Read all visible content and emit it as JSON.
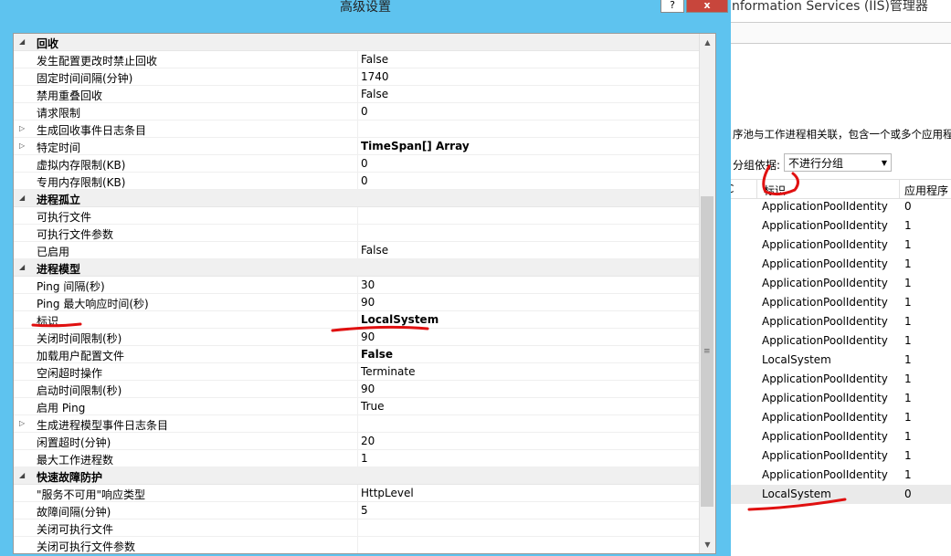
{
  "dialog": {
    "title": "高级设置",
    "help_label": "?",
    "close_label": "x"
  },
  "rows": [
    {
      "type": "category",
      "name": "回收",
      "expanded": true
    },
    {
      "type": "prop",
      "name": "发生配置更改时禁止回收",
      "value": "False"
    },
    {
      "type": "prop",
      "name": "固定时间间隔(分钟)",
      "value": "1740"
    },
    {
      "type": "prop",
      "name": "禁用重叠回收",
      "value": "False"
    },
    {
      "type": "prop",
      "name": "请求限制",
      "value": "0"
    },
    {
      "type": "prop",
      "name": "生成回收事件日志条目",
      "value": "",
      "expandable": true
    },
    {
      "type": "prop",
      "name": "特定时间",
      "value": "TimeSpan[] Array",
      "bold": true,
      "expandable": true
    },
    {
      "type": "prop",
      "name": "虚拟内存限制(KB)",
      "value": "0"
    },
    {
      "type": "prop",
      "name": "专用内存限制(KB)",
      "value": "0"
    },
    {
      "type": "category",
      "name": "进程孤立",
      "expanded": true
    },
    {
      "type": "prop",
      "name": "可执行文件",
      "value": ""
    },
    {
      "type": "prop",
      "name": "可执行文件参数",
      "value": ""
    },
    {
      "type": "prop",
      "name": "已启用",
      "value": "False"
    },
    {
      "type": "category",
      "name": "进程模型",
      "expanded": true
    },
    {
      "type": "prop",
      "name": "Ping 间隔(秒)",
      "value": "30"
    },
    {
      "type": "prop",
      "name": "Ping 最大响应时间(秒)",
      "value": "90"
    },
    {
      "type": "prop",
      "name": "标识",
      "value": "LocalSystem",
      "bold": true
    },
    {
      "type": "prop",
      "name": "关闭时间限制(秒)",
      "value": "90"
    },
    {
      "type": "prop",
      "name": "加载用户配置文件",
      "value": "False",
      "bold": true
    },
    {
      "type": "prop",
      "name": "空闲超时操作",
      "value": "Terminate"
    },
    {
      "type": "prop",
      "name": "启动时间限制(秒)",
      "value": "90"
    },
    {
      "type": "prop",
      "name": "启用 Ping",
      "value": "True"
    },
    {
      "type": "prop",
      "name": "生成进程模型事件日志条目",
      "value": "",
      "expandable": true
    },
    {
      "type": "prop",
      "name": "闲置超时(分钟)",
      "value": "20"
    },
    {
      "type": "prop",
      "name": "最大工作进程数",
      "value": "1"
    },
    {
      "type": "category",
      "name": "快速故障防护",
      "expanded": true
    },
    {
      "type": "prop",
      "name": "\"服务不可用\"响应类型",
      "value": "HttpLevel"
    },
    {
      "type": "prop",
      "name": "故障间隔(分钟)",
      "value": "5"
    },
    {
      "type": "prop",
      "name": "关闭可执行文件",
      "value": ""
    },
    {
      "type": "prop",
      "name": "关闭可执行文件参数",
      "value": ""
    }
  ],
  "background": {
    "title": "nformation Services (IIS)管理器",
    "description": "序池与工作进程相关联，包含一个或多个应用程",
    "group_label": "分组依据:",
    "group_value": "不进行分组",
    "columns": [
      "C",
      "标识",
      "应用程序"
    ],
    "pools": [
      {
        "identity": "ApplicationPoolIdentity",
        "apps": "0"
      },
      {
        "identity": "ApplicationPoolIdentity",
        "apps": "1"
      },
      {
        "identity": "ApplicationPoolIdentity",
        "apps": "1"
      },
      {
        "identity": "ApplicationPoolIdentity",
        "apps": "1"
      },
      {
        "identity": "ApplicationPoolIdentity",
        "apps": "1"
      },
      {
        "identity": "ApplicationPoolIdentity",
        "apps": "1"
      },
      {
        "identity": "ApplicationPoolIdentity",
        "apps": "1"
      },
      {
        "identity": "ApplicationPoolIdentity",
        "apps": "1"
      },
      {
        "identity": "LocalSystem",
        "apps": "1"
      },
      {
        "identity": "ApplicationPoolIdentity",
        "apps": "1"
      },
      {
        "identity": "ApplicationPoolIdentity",
        "apps": "1"
      },
      {
        "identity": "ApplicationPoolIdentity",
        "apps": "1"
      },
      {
        "identity": "ApplicationPoolIdentity",
        "apps": "1"
      },
      {
        "identity": "ApplicationPoolIdentity",
        "apps": "1"
      },
      {
        "identity": "ApplicationPoolIdentity",
        "apps": "1"
      },
      {
        "identity": "LocalSystem",
        "apps": "0",
        "selected": true
      }
    ]
  },
  "scrollbar": {
    "up_icon": "up-arrow-icon",
    "down_icon": "down-arrow-icon",
    "grip": "≡"
  },
  "colors": {
    "title_bar": "#5ec3ef",
    "close_button": "#c8463c",
    "category_bg": "#f0f0f0",
    "annotation": "#e01010"
  }
}
